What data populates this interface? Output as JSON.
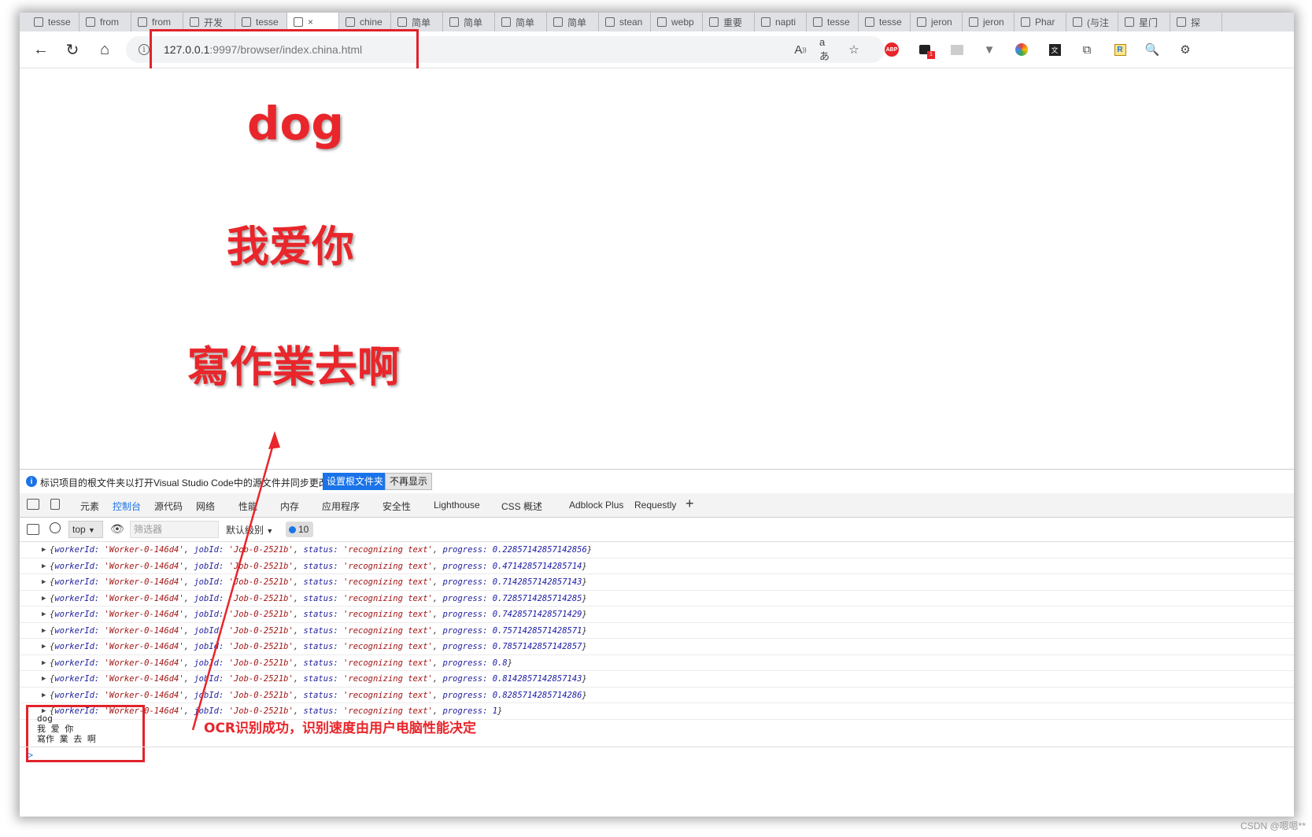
{
  "browser": {
    "tabs": [
      {
        "label": "tesse",
        "active": false
      },
      {
        "label": "from",
        "active": false
      },
      {
        "label": "from",
        "active": false
      },
      {
        "label": "开发",
        "active": false
      },
      {
        "label": "tesse",
        "active": false
      },
      {
        "label": "×",
        "active": true
      },
      {
        "label": "chine",
        "active": false
      },
      {
        "label": "简单",
        "active": false
      },
      {
        "label": "简单",
        "active": false
      },
      {
        "label": "简单",
        "active": false
      },
      {
        "label": "简单",
        "active": false
      },
      {
        "label": "stean",
        "active": false
      },
      {
        "label": "webp",
        "active": false
      },
      {
        "label": "重要",
        "active": false
      },
      {
        "label": "napti",
        "active": false
      },
      {
        "label": "tesse",
        "active": false
      },
      {
        "label": "tesse",
        "active": false
      },
      {
        "label": "jeron",
        "active": false
      },
      {
        "label": "jeron",
        "active": false
      },
      {
        "label": "Phar",
        "active": false
      },
      {
        "label": "(与注",
        "active": false
      },
      {
        "label": "星门",
        "active": false
      },
      {
        "label": "探",
        "active": false
      }
    ],
    "nav": {
      "back_icon": "←",
      "reload_icon": "↻",
      "home_icon": "⌂"
    },
    "url": {
      "host": "127.0.0.1",
      "rest": ":9997/browser/index.china.html"
    },
    "extension_icons": [
      "read-aloud-icon",
      "translate-icon",
      "favorite-icon",
      "adblock-icon",
      "extension-badge-icon",
      "image-icon",
      "vue-icon",
      "color-icon",
      "translate-ext-icon",
      "collections-icon",
      "r-icon",
      "search-ext-icon",
      "extensions-icon"
    ]
  },
  "page": {
    "word1": "dog",
    "word2": "我爱你",
    "word3": "寫作業去啊"
  },
  "devtools": {
    "infobar": {
      "message": "标识项目的根文件夹以打开Visual Studio Code中的源文件并同步更改。",
      "primary_button": "设置根文件夹",
      "secondary_button": "不再显示"
    },
    "tabs": [
      {
        "label": "元素",
        "active": false
      },
      {
        "label": "控制台",
        "active": true
      },
      {
        "label": "源代码",
        "active": false
      },
      {
        "label": "网络",
        "active": false
      },
      {
        "label": "性能",
        "active": false
      },
      {
        "label": "内存",
        "active": false
      },
      {
        "label": "应用程序",
        "active": false
      },
      {
        "label": "安全性",
        "active": false
      },
      {
        "label": "Lighthouse",
        "active": false
      },
      {
        "label": "CSS 概述",
        "active": false
      },
      {
        "label": "Adblock Plus",
        "active": false
      },
      {
        "label": "Requestly",
        "active": false
      },
      {
        "label": "+",
        "active": false
      }
    ],
    "console_toolbar": {
      "context": "top",
      "filter_placeholder": "筛选器",
      "level": "默认级别",
      "message_count": "10"
    },
    "logs": [
      {
        "workerId": "'Worker-0-146d4'",
        "jobId": "'Job-0-2521b'",
        "status": "'recognizing text'",
        "progress": "0.22857142857142856"
      },
      {
        "workerId": "'Worker-0-146d4'",
        "jobId": "'Job-0-2521b'",
        "status": "'recognizing text'",
        "progress": "0.4714285714285714"
      },
      {
        "workerId": "'Worker-0-146d4'",
        "jobId": "'Job-0-2521b'",
        "status": "'recognizing text'",
        "progress": "0.7142857142857143"
      },
      {
        "workerId": "'Worker-0-146d4'",
        "jobId": "'Job-0-2521b'",
        "status": "'recognizing text'",
        "progress": "0.7285714285714285"
      },
      {
        "workerId": "'Worker-0-146d4'",
        "jobId": "'Job-0-2521b'",
        "status": "'recognizing text'",
        "progress": "0.7428571428571429"
      },
      {
        "workerId": "'Worker-0-146d4'",
        "jobId": "'Job-0-2521b'",
        "status": "'recognizing text'",
        "progress": "0.7571428571428571"
      },
      {
        "workerId": "'Worker-0-146d4'",
        "jobId": "'Job-0-2521b'",
        "status": "'recognizing text'",
        "progress": "0.7857142857142857"
      },
      {
        "workerId": "'Worker-0-146d4'",
        "jobId": "'Job-0-2521b'",
        "status": "'recognizing text'",
        "progress": "0.8"
      },
      {
        "workerId": "'Worker-0-146d4'",
        "jobId": "'Job-0-2521b'",
        "status": "'recognizing text'",
        "progress": "0.8142857142857143"
      },
      {
        "workerId": "'Worker-0-146d4'",
        "jobId": "'Job-0-2521b'",
        "status": "'recognizing text'",
        "progress": "0.8285714285714286"
      },
      {
        "workerId": "'Worker-0-146d4'",
        "jobId": "'Job-0-2521b'",
        "status": "'recognizing text'",
        "progress": "1"
      }
    ],
    "output_lines": [
      "dog",
      "我 爱 你",
      "寫作 業 去 啊"
    ],
    "prompt_symbol": ">"
  },
  "annotation": {
    "text": "OCR识别成功，识别速度由用户电脑性能决定",
    "color": "#e8262b"
  },
  "watermark": "CSDN @嗯嗯**"
}
